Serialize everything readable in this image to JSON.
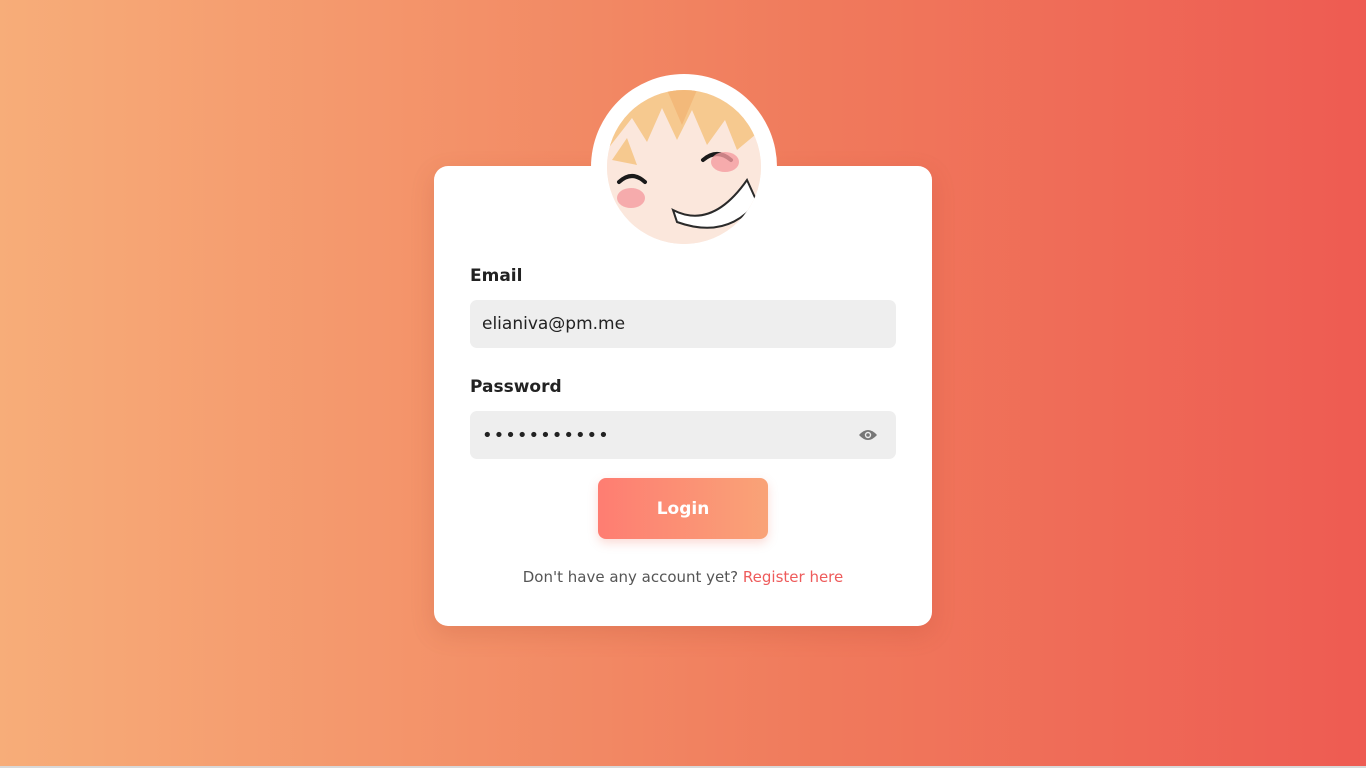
{
  "form": {
    "email_label": "Email",
    "email_value": "elianiva@pm.me",
    "password_label": "Password",
    "password_mask": "•••••••••••",
    "toggle_icon": "eye-icon",
    "login_label": "Login",
    "register_prompt": "Don't have any account yet?",
    "register_link": "Register here"
  },
  "avatar": {
    "icon": "anime-avatar"
  },
  "colors": {
    "background_start": "#f7ad79",
    "background_end": "#ee5b52",
    "button_start": "#fe7d72",
    "button_end": "#f9a377",
    "link": "#ee5b5b"
  }
}
